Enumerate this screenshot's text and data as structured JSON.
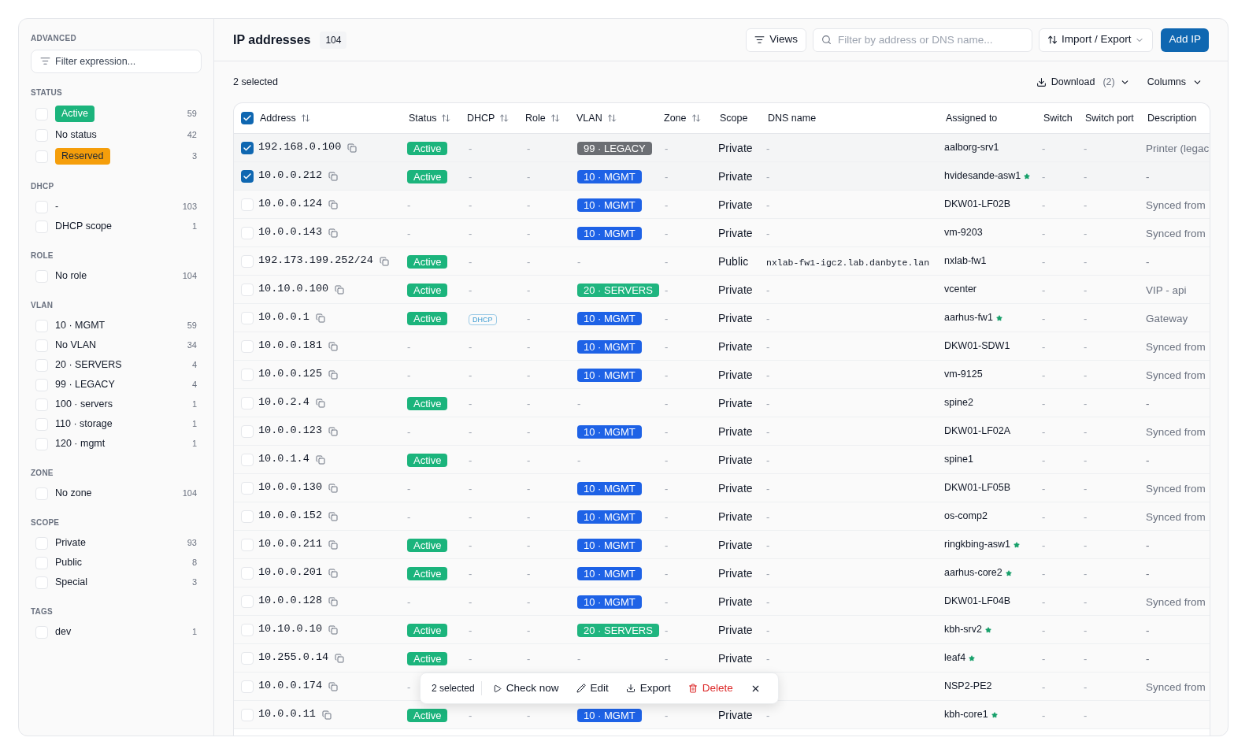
{
  "sidebar": {
    "advanced": {
      "title": "ADVANCED",
      "placeholder": "Filter expression..."
    },
    "sections": [
      {
        "title": "STATUS",
        "items": [
          {
            "label": "Active",
            "count": "59",
            "checked": false,
            "color": "#1bb47c"
          },
          {
            "label": "No status",
            "count": "42",
            "checked": false
          },
          {
            "label": "Reserved",
            "count": "3",
            "checked": false,
            "color": "#f59e0b"
          }
        ]
      },
      {
        "title": "DHCP",
        "items": [
          {
            "label": "-",
            "count": "103",
            "checked": false
          },
          {
            "label": "DHCP scope",
            "count": "1",
            "checked": false
          }
        ]
      },
      {
        "title": "ROLE",
        "items": [
          {
            "label": "No role",
            "count": "104",
            "checked": false
          }
        ]
      },
      {
        "title": "VLAN",
        "items": [
          {
            "label": "10 · MGMT",
            "count": "59",
            "checked": false
          },
          {
            "label": "No VLAN",
            "count": "34",
            "checked": false
          },
          {
            "label": "20 · SERVERS",
            "count": "4",
            "checked": false
          },
          {
            "label": "99 · LEGACY",
            "count": "4",
            "checked": false
          },
          {
            "label": "100 · servers",
            "count": "1",
            "checked": false
          },
          {
            "label": "110 · storage",
            "count": "1",
            "checked": false
          },
          {
            "label": "120 · mgmt",
            "count": "1",
            "checked": false
          }
        ]
      },
      {
        "title": "ZONE",
        "items": [
          {
            "label": "No zone",
            "count": "104",
            "checked": false
          }
        ]
      },
      {
        "title": "SCOPE",
        "items": [
          {
            "label": "Private",
            "count": "93",
            "checked": false
          },
          {
            "label": "Public",
            "count": "8",
            "checked": false
          },
          {
            "label": "Special",
            "count": "3",
            "checked": false
          }
        ]
      },
      {
        "title": "TAGS",
        "items": [
          {
            "label": "dev",
            "count": "1",
            "checked": false
          }
        ]
      }
    ]
  },
  "header": {
    "title": "IP addresses",
    "count": "104",
    "views": "Views",
    "search_placeholder": "Filter by address or DNS name...",
    "import_export": "Import / Export",
    "add": "Add IP"
  },
  "toolbar": {
    "selected": "2 selected",
    "download": "Download",
    "download_count": "(2)",
    "columns": "Columns"
  },
  "table": {
    "all_checked": true,
    "columns": [
      {
        "label": "Address",
        "sortable": true
      },
      {
        "label": "Status",
        "sortable": true
      },
      {
        "label": "DHCP",
        "sortable": true
      },
      {
        "label": "Role",
        "sortable": true
      },
      {
        "label": "VLAN",
        "sortable": true
      },
      {
        "label": "Zone",
        "sortable": true
      },
      {
        "label": "Scope",
        "sortable": false
      },
      {
        "label": "DNS name",
        "sortable": false
      },
      {
        "label": "Assigned to",
        "sortable": false
      },
      {
        "label": "Switch",
        "sortable": false
      },
      {
        "label": "Switch port",
        "sortable": false
      },
      {
        "label": "Description",
        "sortable": false
      }
    ],
    "rows": [
      {
        "selected": true,
        "address": "192.168.0.100",
        "status": {
          "label": "Active",
          "color": "#1bb47c"
        },
        "dhcp": "-",
        "role": "-",
        "vlan": {
          "label": "99 · LEGACY",
          "color": "#6b6e73"
        },
        "zone": "-",
        "scope": "Private",
        "dns": "-",
        "assigned": {
          "name": "aalborg-srv1",
          "starred": false
        },
        "switch": "-",
        "port": "-",
        "description": "Printer (legac"
      },
      {
        "selected": true,
        "address": "10.0.0.212",
        "status": {
          "label": "Active",
          "color": "#1bb47c"
        },
        "dhcp": "-",
        "role": "-",
        "vlan": {
          "label": "10 · MGMT",
          "color": "#1e62e6"
        },
        "zone": "-",
        "scope": "Private",
        "dns": "-",
        "assigned": {
          "name": "hvidesande-asw1",
          "starred": true
        },
        "switch": "-",
        "port": "-",
        "description": "-"
      },
      {
        "selected": false,
        "address": "10.0.0.124",
        "status": "-",
        "dhcp": "-",
        "role": "-",
        "vlan": {
          "label": "10 · MGMT",
          "color": "#1e62e6"
        },
        "zone": "-",
        "scope": "Private",
        "dns": "-",
        "assigned": {
          "name": "DKW01-LF02B",
          "starred": false
        },
        "switch": "-",
        "port": "-",
        "description": "Synced from"
      },
      {
        "selected": false,
        "address": "10.0.0.143",
        "status": "-",
        "dhcp": "-",
        "role": "-",
        "vlan": {
          "label": "10 · MGMT",
          "color": "#1e62e6"
        },
        "zone": "-",
        "scope": "Private",
        "dns": "-",
        "assigned": {
          "name": "vm-9203",
          "starred": false
        },
        "switch": "-",
        "port": "-",
        "description": "Synced from"
      },
      {
        "selected": false,
        "address": "192.173.199.252/24",
        "status": {
          "label": "Active",
          "color": "#1bb47c"
        },
        "dhcp": "-",
        "role": "-",
        "vlan": "-",
        "zone": "-",
        "scope": "Public",
        "dns": "nxlab-fw1-igc2.lab.danbyte.lan",
        "assigned": {
          "name": "nxlab-fw1",
          "starred": false
        },
        "switch": "-",
        "port": "-",
        "description": "-"
      },
      {
        "selected": false,
        "address": "10.10.0.100",
        "status": {
          "label": "Active",
          "color": "#1bb47c"
        },
        "dhcp": "-",
        "role": "-",
        "vlan": {
          "label": "20 · SERVERS",
          "color": "#1fb57f"
        },
        "zone": "-",
        "scope": "Private",
        "dns": "-",
        "assigned": {
          "name": "vcenter",
          "starred": false
        },
        "switch": "-",
        "port": "-",
        "description": "VIP - api"
      },
      {
        "selected": false,
        "address": "10.0.0.1",
        "status": {
          "label": "Active",
          "color": "#1bb47c"
        },
        "dhcp": {
          "label": "DHCP"
        },
        "role": "-",
        "vlan": {
          "label": "10 · MGMT",
          "color": "#1e62e6"
        },
        "zone": "-",
        "scope": "Private",
        "dns": "-",
        "assigned": {
          "name": "aarhus-fw1",
          "starred": true
        },
        "switch": "-",
        "port": "-",
        "description": "Gateway"
      },
      {
        "selected": false,
        "address": "10.0.0.181",
        "status": "-",
        "dhcp": "-",
        "role": "-",
        "vlan": {
          "label": "10 · MGMT",
          "color": "#1e62e6"
        },
        "zone": "-",
        "scope": "Private",
        "dns": "-",
        "assigned": {
          "name": "DKW01-SDW1",
          "starred": false
        },
        "switch": "-",
        "port": "-",
        "description": "Synced from"
      },
      {
        "selected": false,
        "address": "10.0.0.125",
        "status": "-",
        "dhcp": "-",
        "role": "-",
        "vlan": {
          "label": "10 · MGMT",
          "color": "#1e62e6"
        },
        "zone": "-",
        "scope": "Private",
        "dns": "-",
        "assigned": {
          "name": "vm-9125",
          "starred": false
        },
        "switch": "-",
        "port": "-",
        "description": "Synced from"
      },
      {
        "selected": false,
        "address": "10.0.2.4",
        "status": {
          "label": "Active",
          "color": "#1bb47c"
        },
        "dhcp": "-",
        "role": "-",
        "vlan": "-",
        "zone": "-",
        "scope": "Private",
        "dns": "-",
        "assigned": {
          "name": "spine2",
          "starred": false
        },
        "switch": "-",
        "port": "-",
        "description": "-"
      },
      {
        "selected": false,
        "address": "10.0.0.123",
        "status": "-",
        "dhcp": "-",
        "role": "-",
        "vlan": {
          "label": "10 · MGMT",
          "color": "#1e62e6"
        },
        "zone": "-",
        "scope": "Private",
        "dns": "-",
        "assigned": {
          "name": "DKW01-LF02A",
          "starred": false
        },
        "switch": "-",
        "port": "-",
        "description": "Synced from"
      },
      {
        "selected": false,
        "address": "10.0.1.4",
        "status": {
          "label": "Active",
          "color": "#1bb47c"
        },
        "dhcp": "-",
        "role": "-",
        "vlan": "-",
        "zone": "-",
        "scope": "Private",
        "dns": "-",
        "assigned": {
          "name": "spine1",
          "starred": false
        },
        "switch": "-",
        "port": "-",
        "description": "-"
      },
      {
        "selected": false,
        "address": "10.0.0.130",
        "status": "-",
        "dhcp": "-",
        "role": "-",
        "vlan": {
          "label": "10 · MGMT",
          "color": "#1e62e6"
        },
        "zone": "-",
        "scope": "Private",
        "dns": "-",
        "assigned": {
          "name": "DKW01-LF05B",
          "starred": false
        },
        "switch": "-",
        "port": "-",
        "description": "Synced from"
      },
      {
        "selected": false,
        "address": "10.0.0.152",
        "status": "-",
        "dhcp": "-",
        "role": "-",
        "vlan": {
          "label": "10 · MGMT",
          "color": "#1e62e6"
        },
        "zone": "-",
        "scope": "Private",
        "dns": "-",
        "assigned": {
          "name": "os-comp2",
          "starred": false
        },
        "switch": "-",
        "port": "-",
        "description": "Synced from"
      },
      {
        "selected": false,
        "address": "10.0.0.211",
        "status": {
          "label": "Active",
          "color": "#1bb47c"
        },
        "dhcp": "-",
        "role": "-",
        "vlan": {
          "label": "10 · MGMT",
          "color": "#1e62e6"
        },
        "zone": "-",
        "scope": "Private",
        "dns": "-",
        "assigned": {
          "name": "ringkbing-asw1",
          "starred": true
        },
        "switch": "-",
        "port": "-",
        "description": "-"
      },
      {
        "selected": false,
        "address": "10.0.0.201",
        "status": {
          "label": "Active",
          "color": "#1bb47c"
        },
        "dhcp": "-",
        "role": "-",
        "vlan": {
          "label": "10 · MGMT",
          "color": "#1e62e6"
        },
        "zone": "-",
        "scope": "Private",
        "dns": "-",
        "assigned": {
          "name": "aarhus-core2",
          "starred": true
        },
        "switch": "-",
        "port": "-",
        "description": "-"
      },
      {
        "selected": false,
        "address": "10.0.0.128",
        "status": "-",
        "dhcp": "-",
        "role": "-",
        "vlan": {
          "label": "10 · MGMT",
          "color": "#1e62e6"
        },
        "zone": "-",
        "scope": "Private",
        "dns": "-",
        "assigned": {
          "name": "DKW01-LF04B",
          "starred": false
        },
        "switch": "-",
        "port": "-",
        "description": "Synced from"
      },
      {
        "selected": false,
        "address": "10.10.0.10",
        "status": {
          "label": "Active",
          "color": "#1bb47c"
        },
        "dhcp": "-",
        "role": "-",
        "vlan": {
          "label": "20 · SERVERS",
          "color": "#1fb57f"
        },
        "zone": "-",
        "scope": "Private",
        "dns": "-",
        "assigned": {
          "name": "kbh-srv2",
          "starred": true
        },
        "switch": "-",
        "port": "-",
        "description": "-"
      },
      {
        "selected": false,
        "address": "10.255.0.14",
        "status": {
          "label": "Active",
          "color": "#1bb47c"
        },
        "dhcp": "-",
        "role": "-",
        "vlan": "-",
        "zone": "-",
        "scope": "Private",
        "dns": "-",
        "assigned": {
          "name": "leaf4",
          "starred": true
        },
        "switch": "-",
        "port": "-",
        "description": "-"
      },
      {
        "selected": false,
        "address": "10.0.0.174",
        "status": "-",
        "assigned": {
          "name": "NSP2-PE2",
          "starred": false
        },
        "switch": "-",
        "port": "-",
        "description": "Synced from"
      },
      {
        "selected": false,
        "address": "10.0.0.11",
        "status": {
          "label": "Active",
          "color": "#1bb47c"
        },
        "dhcp": "-",
        "role": "-",
        "vlan": {
          "label": "10 · MGMT",
          "color": "#1e62e6"
        },
        "zone": "-",
        "scope": "Private",
        "dns": "-",
        "assigned": {
          "name": "kbh-core1",
          "starred": true
        },
        "switch": "-",
        "port": "-"
      }
    ]
  },
  "action_bar": {
    "selected": "2 selected",
    "check": "Check now",
    "edit": "Edit",
    "export": "Export",
    "delete": "Delete"
  }
}
